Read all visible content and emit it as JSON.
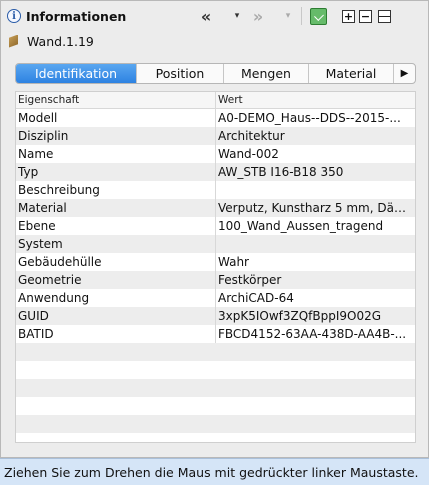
{
  "header": {
    "title": "Informationen",
    "info_icon": "i",
    "back_icon": "«",
    "dropdown_icon": "▾",
    "forward_icon": "»",
    "expand_icon": "+",
    "collapse_icon": "−"
  },
  "element": {
    "name": "Wand.1.19"
  },
  "tabs": [
    {
      "label": "Identifikation",
      "active": true
    },
    {
      "label": "Position"
    },
    {
      "label": "Mengen"
    },
    {
      "label": "Material"
    },
    {
      "label": "▶"
    }
  ],
  "table": {
    "columns": [
      "Eigenschaft",
      "Wert"
    ],
    "rows": [
      {
        "property": "Modell",
        "value": "A0-DEMO_Haus--DDS--2015-..."
      },
      {
        "property": "Disziplin",
        "value": "Architektur"
      },
      {
        "property": "Name",
        "value": "Wand-002"
      },
      {
        "property": "Typ",
        "value": "AW_STB I16-B18 350"
      },
      {
        "property": "Beschreibung",
        "value": ""
      },
      {
        "property": "Material",
        "value": "Verputz, Kunstharz 5 mm, Däm..."
      },
      {
        "property": "Ebene",
        "value": "100_Wand_Aussen_tragend"
      },
      {
        "property": "System",
        "value": ""
      },
      {
        "property": "Gebäudehülle",
        "value": "Wahr"
      },
      {
        "property": "Geometrie",
        "value": "Festkörper"
      },
      {
        "property": "Anwendung",
        "value": "ArchiCAD-64"
      },
      {
        "property": "GUID",
        "value": "3xpK5IOwf3ZQfBppI9O02G"
      },
      {
        "property": "BATID",
        "value": "FBCD4152-63AA-438D-AA4B-..."
      }
    ]
  },
  "status_bar": {
    "text": "Ziehen Sie zum Drehen die Maus mit gedrückter linker Maustaste."
  }
}
